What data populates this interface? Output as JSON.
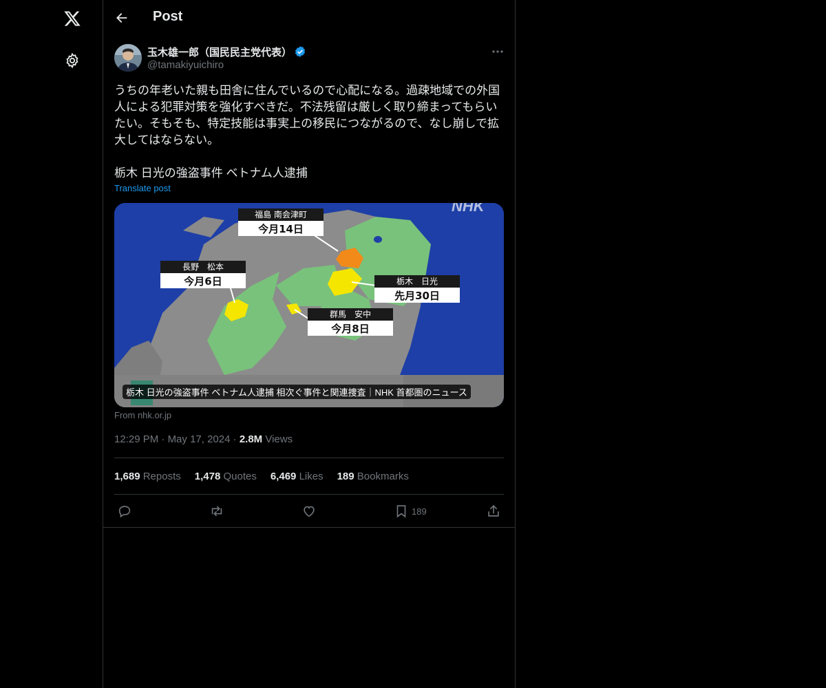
{
  "nav": {
    "logo_icon": "x-logo-icon",
    "settings_icon": "gear-icon"
  },
  "header": {
    "back_icon": "arrow-left-icon",
    "title": "Post"
  },
  "author": {
    "name": "玉木雄一郎（国民民主党代表）",
    "handle": "@tamakiyuichiro",
    "verified_color": "#1d9bf0"
  },
  "post": {
    "text": "うちの年老いた親も田舎に住んでいるので心配になる。過疎地域での外国人による犯罪対策を強化すべきだ。不法残留は厳しく取り締まってもらいたい。そもそも、特定技能は事実上の移民につながるので、なし崩しで拡大してはならない。",
    "headline": "栃木 日光の強盗事件 ベトナム人逮捕",
    "translate_label": "Translate post"
  },
  "card": {
    "watermark": "NHK",
    "labels": [
      {
        "place": "福島 南会津町",
        "date": "今月14日"
      },
      {
        "place": "長野　松本",
        "date": "今月6日"
      },
      {
        "place": "栃木　日光",
        "date": "先月30日"
      },
      {
        "place": "群馬　安中",
        "date": "今月8日"
      }
    ],
    "caption": "栃木 日光の強盗事件 ベトナム人逮捕 相次ぐ事件と関連捜査｜NHK 首都圏のニュース",
    "source": "From nhk.or.jp"
  },
  "meta": {
    "time": "12:29 PM",
    "date": "May 17, 2024",
    "views_count": "2.8M",
    "views_label": "Views",
    "sep": "·"
  },
  "stats": {
    "reposts_count": "1,689",
    "reposts_label": "Reposts",
    "quotes_count": "1,478",
    "quotes_label": "Quotes",
    "likes_count": "6,469",
    "likes_label": "Likes",
    "bookmarks_count": "189",
    "bookmarks_label": "Bookmarks"
  },
  "actions": {
    "reply_icon": "reply-icon",
    "repost_icon": "repost-icon",
    "like_icon": "heart-icon",
    "bookmark_icon": "bookmark-icon",
    "bookmark_count": "189",
    "share_icon": "share-icon"
  }
}
